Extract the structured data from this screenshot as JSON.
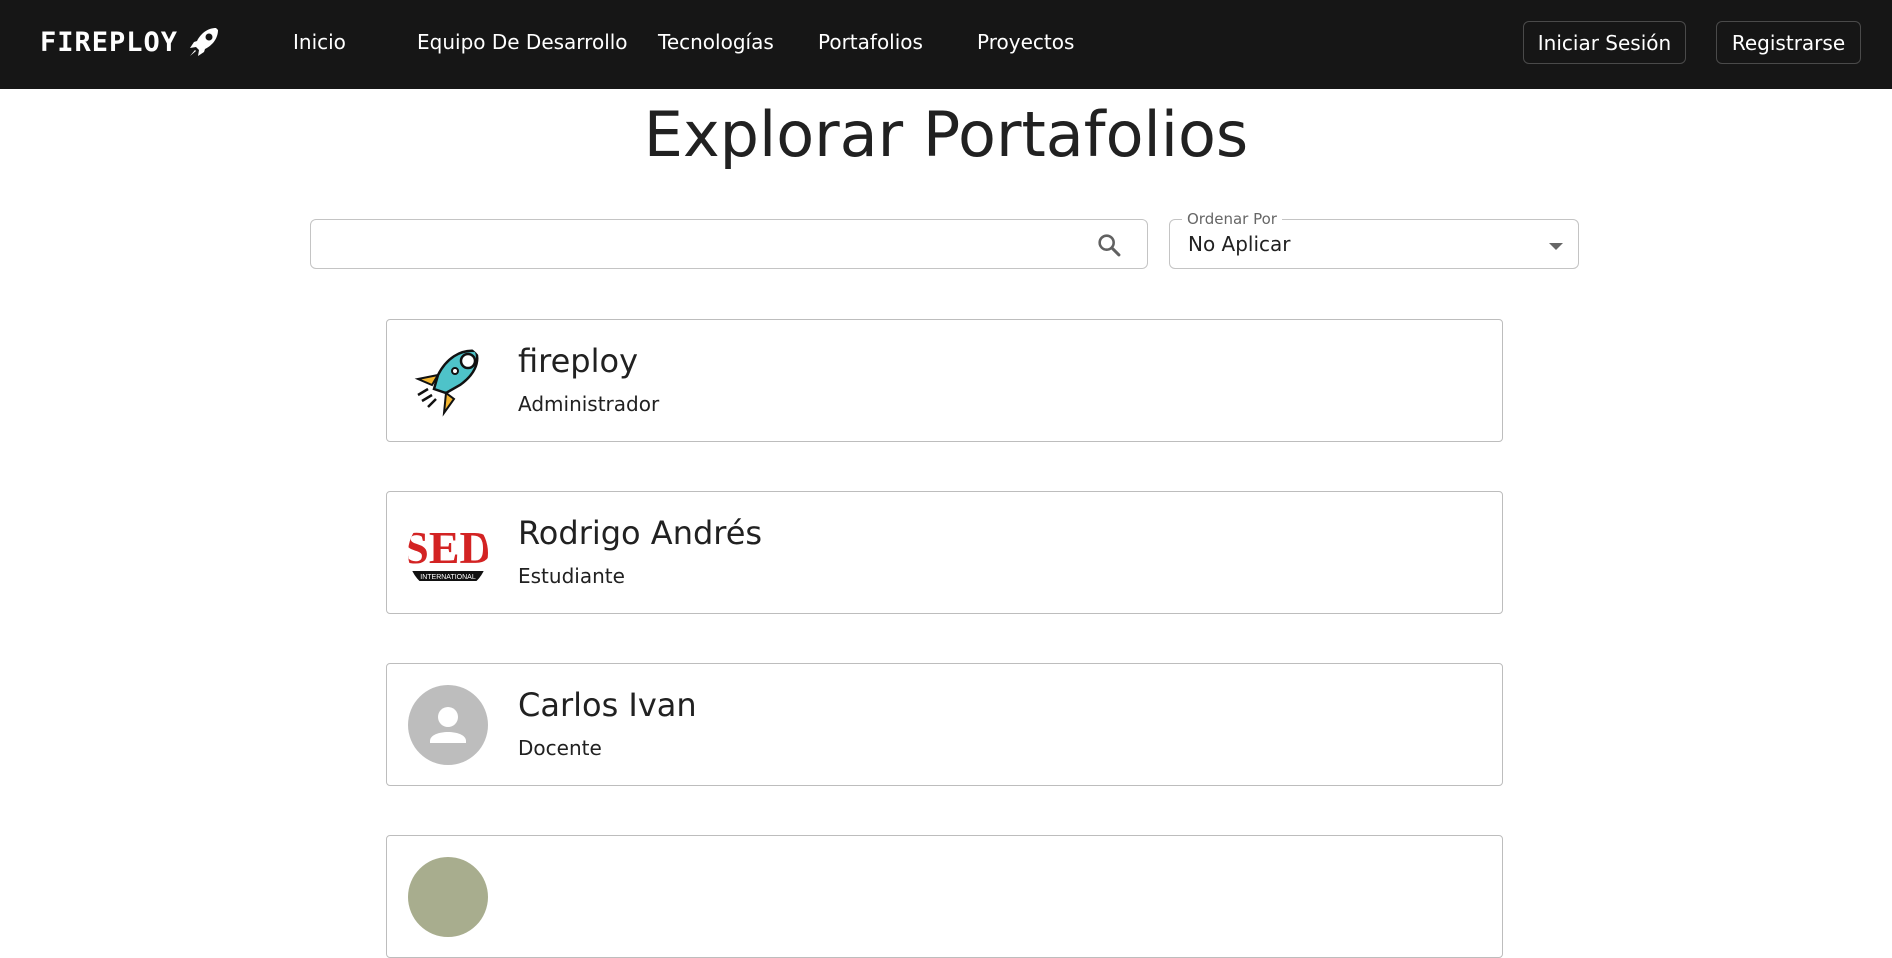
{
  "brand": {
    "name": "FIREPLOY"
  },
  "nav": {
    "links": [
      "Inicio",
      "Equipo De Desarrollo",
      "Tecnologías",
      "Portafolios",
      "Proyectos"
    ],
    "login": "Iniciar Sesión",
    "register": "Registrarse"
  },
  "page": {
    "title": "Explorar Portafolios"
  },
  "search": {
    "value": "",
    "icon": "search-icon"
  },
  "order": {
    "label": "Ordenar Por",
    "selected": "No Aplicar"
  },
  "portfolios": [
    {
      "name": "fireploy",
      "role": "Administrador",
      "avatar": "rocket-logo"
    },
    {
      "name": "Rodrigo Andrés",
      "role": "Estudiante",
      "avatar": "sed-logo",
      "avatar_text": "SED",
      "avatar_subtext": "INTERNATIONAL"
    },
    {
      "name": "Carlos Ivan",
      "role": "Docente",
      "avatar": "default-user"
    },
    {
      "name": "",
      "role": "",
      "avatar": "photo"
    }
  ],
  "colors": {
    "navbar": "#161616",
    "rocket_body": "#4ec3c9",
    "flame": "#f5b731",
    "sed_red": "#d32323"
  }
}
